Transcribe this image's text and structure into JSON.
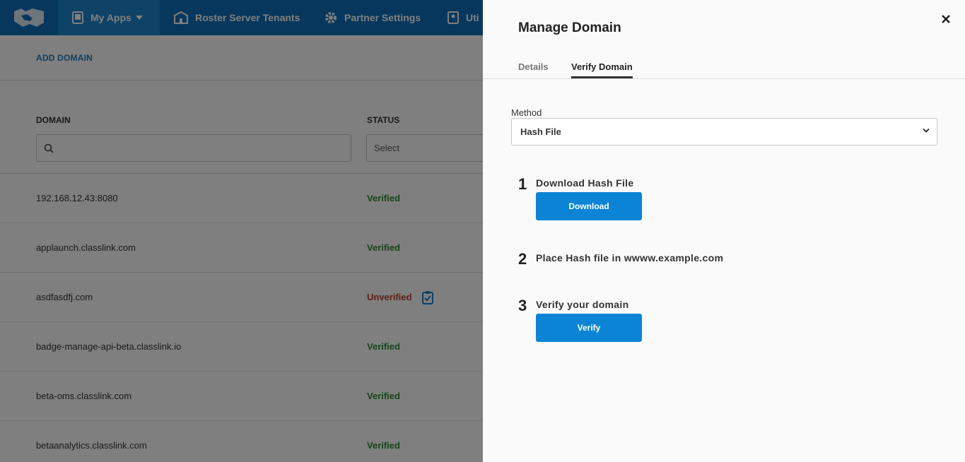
{
  "nav": {
    "my_apps": "My Apps",
    "roster_server_tenants": "Roster Server Tenants",
    "partner_settings": "Partner Settings",
    "utilities": "Uti"
  },
  "toolbar": {
    "add_domain": "ADD DOMAIN"
  },
  "table": {
    "headers": {
      "domain": "DOMAIN",
      "status": "STATUS"
    },
    "status_filter_placeholder": "Select",
    "rows": [
      {
        "domain": "192.168.12.43:8080",
        "status": "Verified"
      },
      {
        "domain": "applaunch.classlink.com",
        "status": "Verified"
      },
      {
        "domain": "asdfasdfj.com",
        "status": "Unverified"
      },
      {
        "domain": "badge-manage-api-beta.classlink.io",
        "status": "Verified"
      },
      {
        "domain": "beta-oms.classlink.com",
        "status": "Verified"
      },
      {
        "domain": "betaanalytics.classlink.com",
        "status": "Verified"
      }
    ]
  },
  "drawer": {
    "title": "Manage Domain",
    "tabs": [
      "Details",
      "Verify Domain"
    ],
    "active_tab": "Verify Domain",
    "method_label": "Method",
    "method_value": "Hash File",
    "steps": [
      {
        "number": "1",
        "text": "Download Hash File",
        "button": "Download"
      },
      {
        "number": "2",
        "text": "Place Hash file in wwww.example.com"
      },
      {
        "number": "3",
        "text": "Verify your domain",
        "button": "Verify"
      }
    ]
  },
  "colors": {
    "brand_blue": "#0f6fb8",
    "button_blue": "#0b84d6",
    "verified_green": "#2e8b2e",
    "unverified_red": "#c0392b"
  }
}
